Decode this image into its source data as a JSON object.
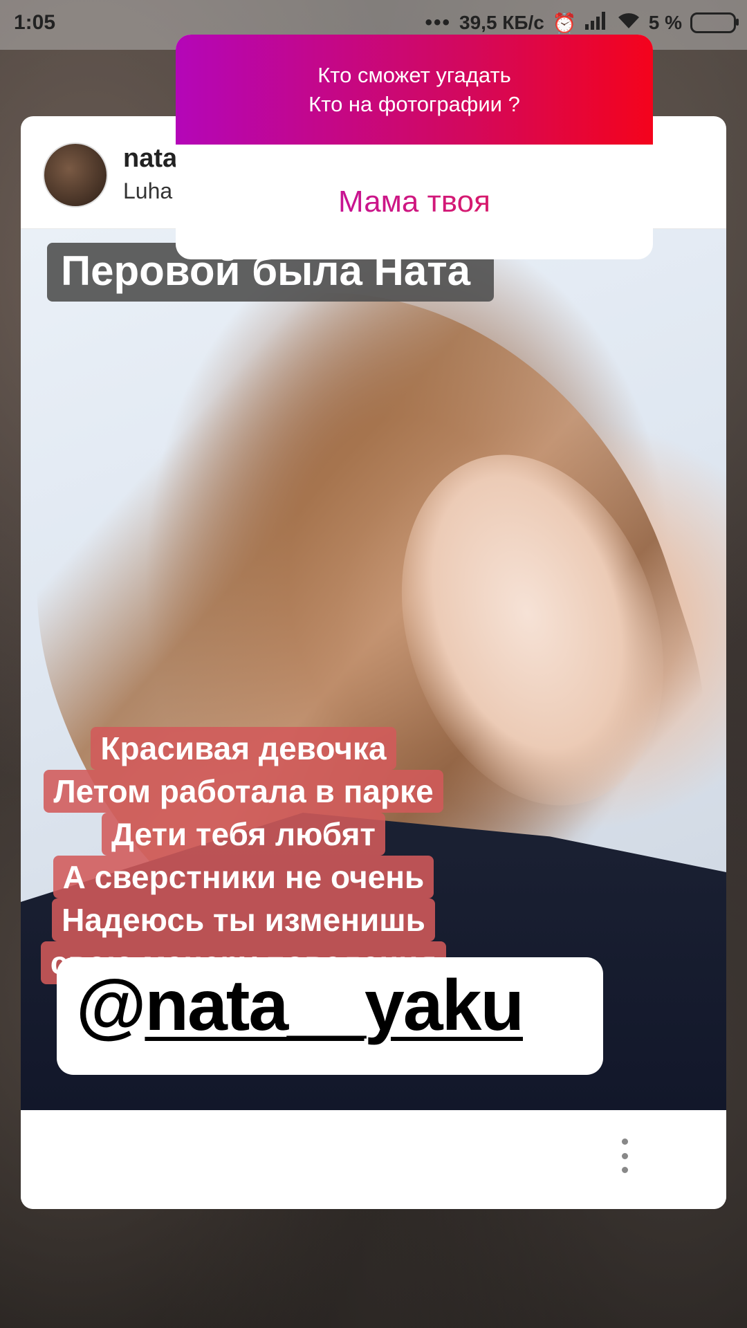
{
  "status_bar": {
    "time": "1:05",
    "network_speed": "39,5 КБ/с",
    "battery": "5 %"
  },
  "post": {
    "username": "nata",
    "location": "Luha",
    "caption_title": "Перовой была Ната",
    "caption_lines": [
      "Красивая девочка",
      "Летом работала в парке",
      "Дети тебя любят",
      "А сверстники не очень",
      "Надеюсь ты изменишь",
      "свою манеру поведения"
    ],
    "mention_prefix": "@",
    "mention_handle": "nata__yaku"
  },
  "question_sticker": {
    "question_line1": "Кто сможет угадать",
    "question_line2": "Кто на фотографии ?",
    "answer": "Мама твоя"
  },
  "colors": {
    "sticker_gradient_start": "#b406b8",
    "sticker_gradient_end": "#f4031c",
    "caption_highlight": "#d25a5a"
  }
}
